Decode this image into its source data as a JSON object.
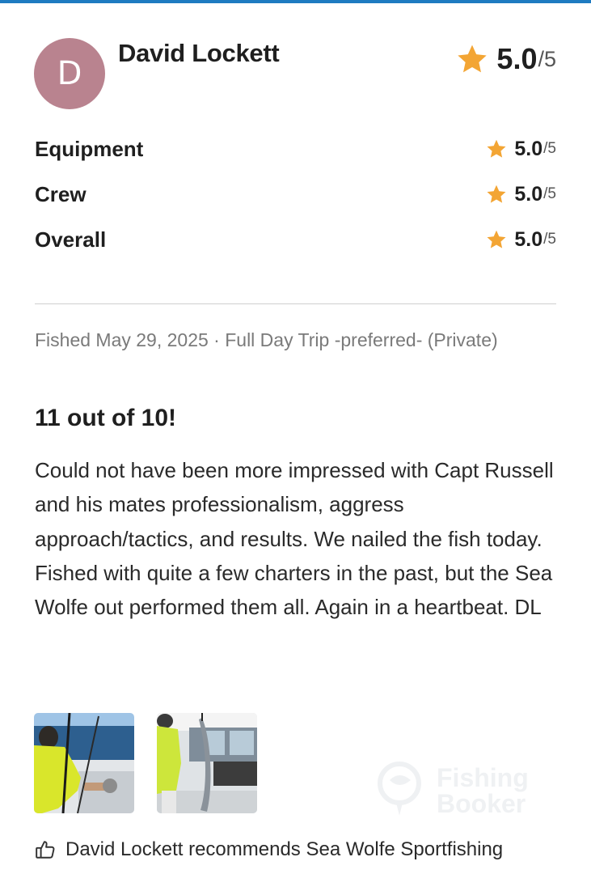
{
  "reviewer": {
    "initial": "D",
    "name": "David Lockett"
  },
  "overall_rating": {
    "value": "5.0",
    "max": "/5",
    "icon": "star-icon",
    "color": "#f3a534"
  },
  "categories": [
    {
      "label": "Equipment",
      "value": "5.0",
      "max": "/5"
    },
    {
      "label": "Crew",
      "value": "5.0",
      "max": "/5"
    },
    {
      "label": "Overall",
      "value": "5.0",
      "max": "/5"
    }
  ],
  "trip": {
    "meta": "Fished May 29, 2025 · Full Day Trip -preferred- (Private)"
  },
  "review": {
    "title": "11 out of 10!",
    "paragraphs": [
      "Could not have been more impressed with Capt Russell and his mates professionalism, aggress approach/tactics, and results.  We nailed the fish today.",
      "Fished with quite a few charters in the past, but the Sea Wolfe out performed them all.  Again in a heartbeat.  DL"
    ]
  },
  "photos": [
    {
      "name": "fishing-photo-1"
    },
    {
      "name": "fishing-photo-2"
    }
  ],
  "watermark": {
    "line1": "Fishing",
    "line2": "Booker"
  },
  "recommendation": {
    "icon": "thumbs-up-icon",
    "text": "David Lockett recommends Sea Wolfe Sportfishing"
  },
  "colors": {
    "accent_bar": "#1f7bc1",
    "avatar_bg": "#b9838f",
    "star": "#f3a534"
  }
}
